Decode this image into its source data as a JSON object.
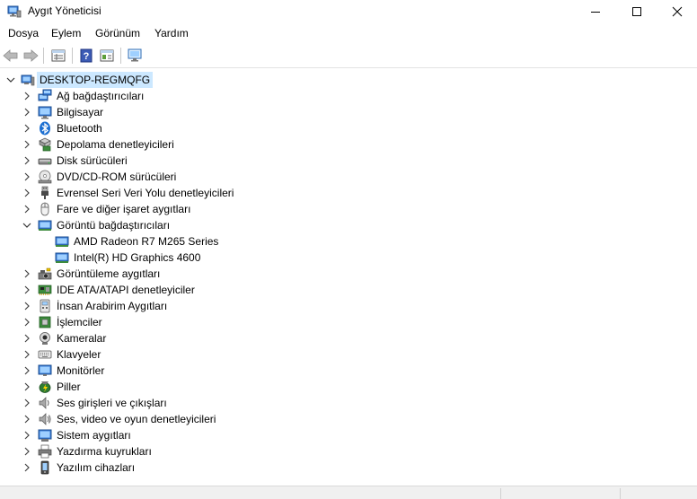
{
  "window": {
    "title": "Aygıt Yöneticisi"
  },
  "menu": [
    "Dosya",
    "Eylem",
    "Görünüm",
    "Yardım"
  ],
  "toolbar": [
    "back-icon",
    "forward-icon",
    "properties-icon",
    "help-icon",
    "properties-pane-icon",
    "monitor-scan-icon"
  ],
  "tree": {
    "root": "DESKTOP-REGMQFG",
    "categories": [
      {
        "label": "Ağ bağdaştırıcıları",
        "icon": "network-adapter-icon",
        "expanded": false
      },
      {
        "label": "Bilgisayar",
        "icon": "computer-icon",
        "expanded": false
      },
      {
        "label": "Bluetooth",
        "icon": "bluetooth-icon",
        "expanded": false
      },
      {
        "label": "Depolama denetleyicileri",
        "icon": "storage-controller-icon",
        "expanded": false
      },
      {
        "label": "Disk sürücüleri",
        "icon": "disk-drive-icon",
        "expanded": false
      },
      {
        "label": "DVD/CD-ROM sürücüleri",
        "icon": "dvd-drive-icon",
        "expanded": false
      },
      {
        "label": "Evrensel Seri Veri Yolu denetleyicileri",
        "icon": "usb-icon",
        "expanded": false
      },
      {
        "label": "Fare ve diğer işaret aygıtları",
        "icon": "mouse-icon",
        "expanded": false
      },
      {
        "label": "Görüntü bağdaştırıcıları",
        "icon": "display-adapter-icon",
        "expanded": true,
        "children": [
          "AMD Radeon R7 M265 Series",
          "Intel(R) HD Graphics 4600"
        ]
      },
      {
        "label": "Görüntüleme aygıtları",
        "icon": "imaging-device-icon",
        "expanded": false
      },
      {
        "label": "IDE ATA/ATAPI denetleyiciler",
        "icon": "ide-controller-icon",
        "expanded": false
      },
      {
        "label": "İnsan Arabirim Aygıtları",
        "icon": "hid-icon",
        "expanded": false
      },
      {
        "label": "İşlemciler",
        "icon": "processor-icon",
        "expanded": false
      },
      {
        "label": "Kameralar",
        "icon": "camera-icon",
        "expanded": false
      },
      {
        "label": "Klavyeler",
        "icon": "keyboard-icon",
        "expanded": false
      },
      {
        "label": "Monitörler",
        "icon": "monitor-icon",
        "expanded": false
      },
      {
        "label": "Piller",
        "icon": "battery-icon",
        "expanded": false
      },
      {
        "label": "Ses girişleri ve çıkışları",
        "icon": "audio-io-icon",
        "expanded": false
      },
      {
        "label": "Ses, video ve oyun denetleyicileri",
        "icon": "sound-controller-icon",
        "expanded": false
      },
      {
        "label": "Sistem aygıtları",
        "icon": "system-device-icon",
        "expanded": false
      },
      {
        "label": "Yazdırma kuyrukları",
        "icon": "print-queue-icon",
        "expanded": false
      },
      {
        "label": "Yazılım cihazları",
        "icon": "software-device-icon",
        "expanded": false
      }
    ]
  }
}
